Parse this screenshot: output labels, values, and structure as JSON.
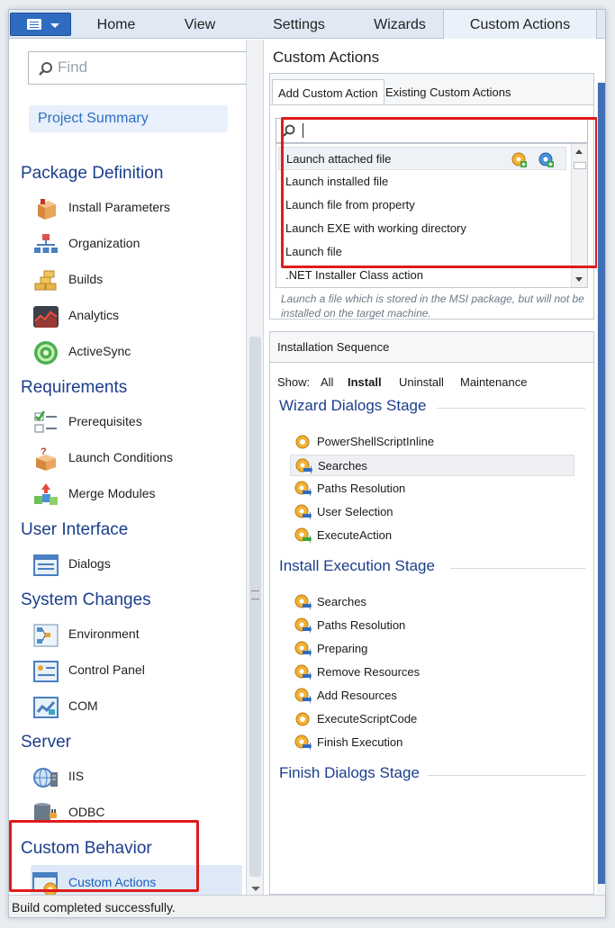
{
  "menu": {
    "items": [
      "Home",
      "View",
      "Settings",
      "Wizards",
      "Custom Actions"
    ]
  },
  "left": {
    "search_placeholder": "Find",
    "project_summary": "Project Summary",
    "sections": [
      {
        "title": "Package Definition",
        "items": [
          "Install Parameters",
          "Organization",
          "Builds",
          "Analytics",
          "ActiveSync"
        ]
      },
      {
        "title": "Requirements",
        "items": [
          "Prerequisites",
          "Launch Conditions",
          "Merge Modules"
        ]
      },
      {
        "title": "User Interface",
        "items": [
          "Dialogs"
        ]
      },
      {
        "title": "System Changes",
        "items": [
          "Environment",
          "Control Panel",
          "COM"
        ]
      },
      {
        "title": "Server",
        "items": [
          "IIS",
          "ODBC"
        ]
      },
      {
        "title": "Custom Behavior",
        "items": [
          "Custom Actions"
        ]
      }
    ]
  },
  "right": {
    "title": "Custom Actions",
    "tabs": [
      "Add Custom Action",
      "Existing Custom Actions"
    ],
    "actions": [
      "Launch attached file",
      "Launch installed file",
      "Launch file from property",
      "Launch EXE with working directory",
      "Launch file",
      ".NET Installer Class action"
    ],
    "description": "Launch a file which is stored in the MSI package, but will not be installed on the target machine.",
    "sequence": {
      "title": "Installation Sequence",
      "show_label": "Show:",
      "filters": [
        "All",
        "Install",
        "Uninstall",
        "Maintenance"
      ],
      "stages": [
        {
          "name": "Wizard Dialogs Stage",
          "items": [
            "PowerShellScriptInline",
            "Searches",
            "Paths Resolution",
            "User Selection",
            "ExecuteAction"
          ]
        },
        {
          "name": "Install Execution Stage",
          "items": [
            "Searches",
            "Paths Resolution",
            "Preparing",
            "Remove Resources",
            "Add Resources",
            "ExecuteScriptCode",
            "Finish Execution"
          ]
        },
        {
          "name": "Finish Dialogs Stage",
          "items": []
        }
      ]
    }
  },
  "status": "Build completed successfully.",
  "colors": {
    "accent": "#2f6cc0",
    "section_title": "#1b3e8c",
    "highlight_box": "#e01b1b"
  }
}
